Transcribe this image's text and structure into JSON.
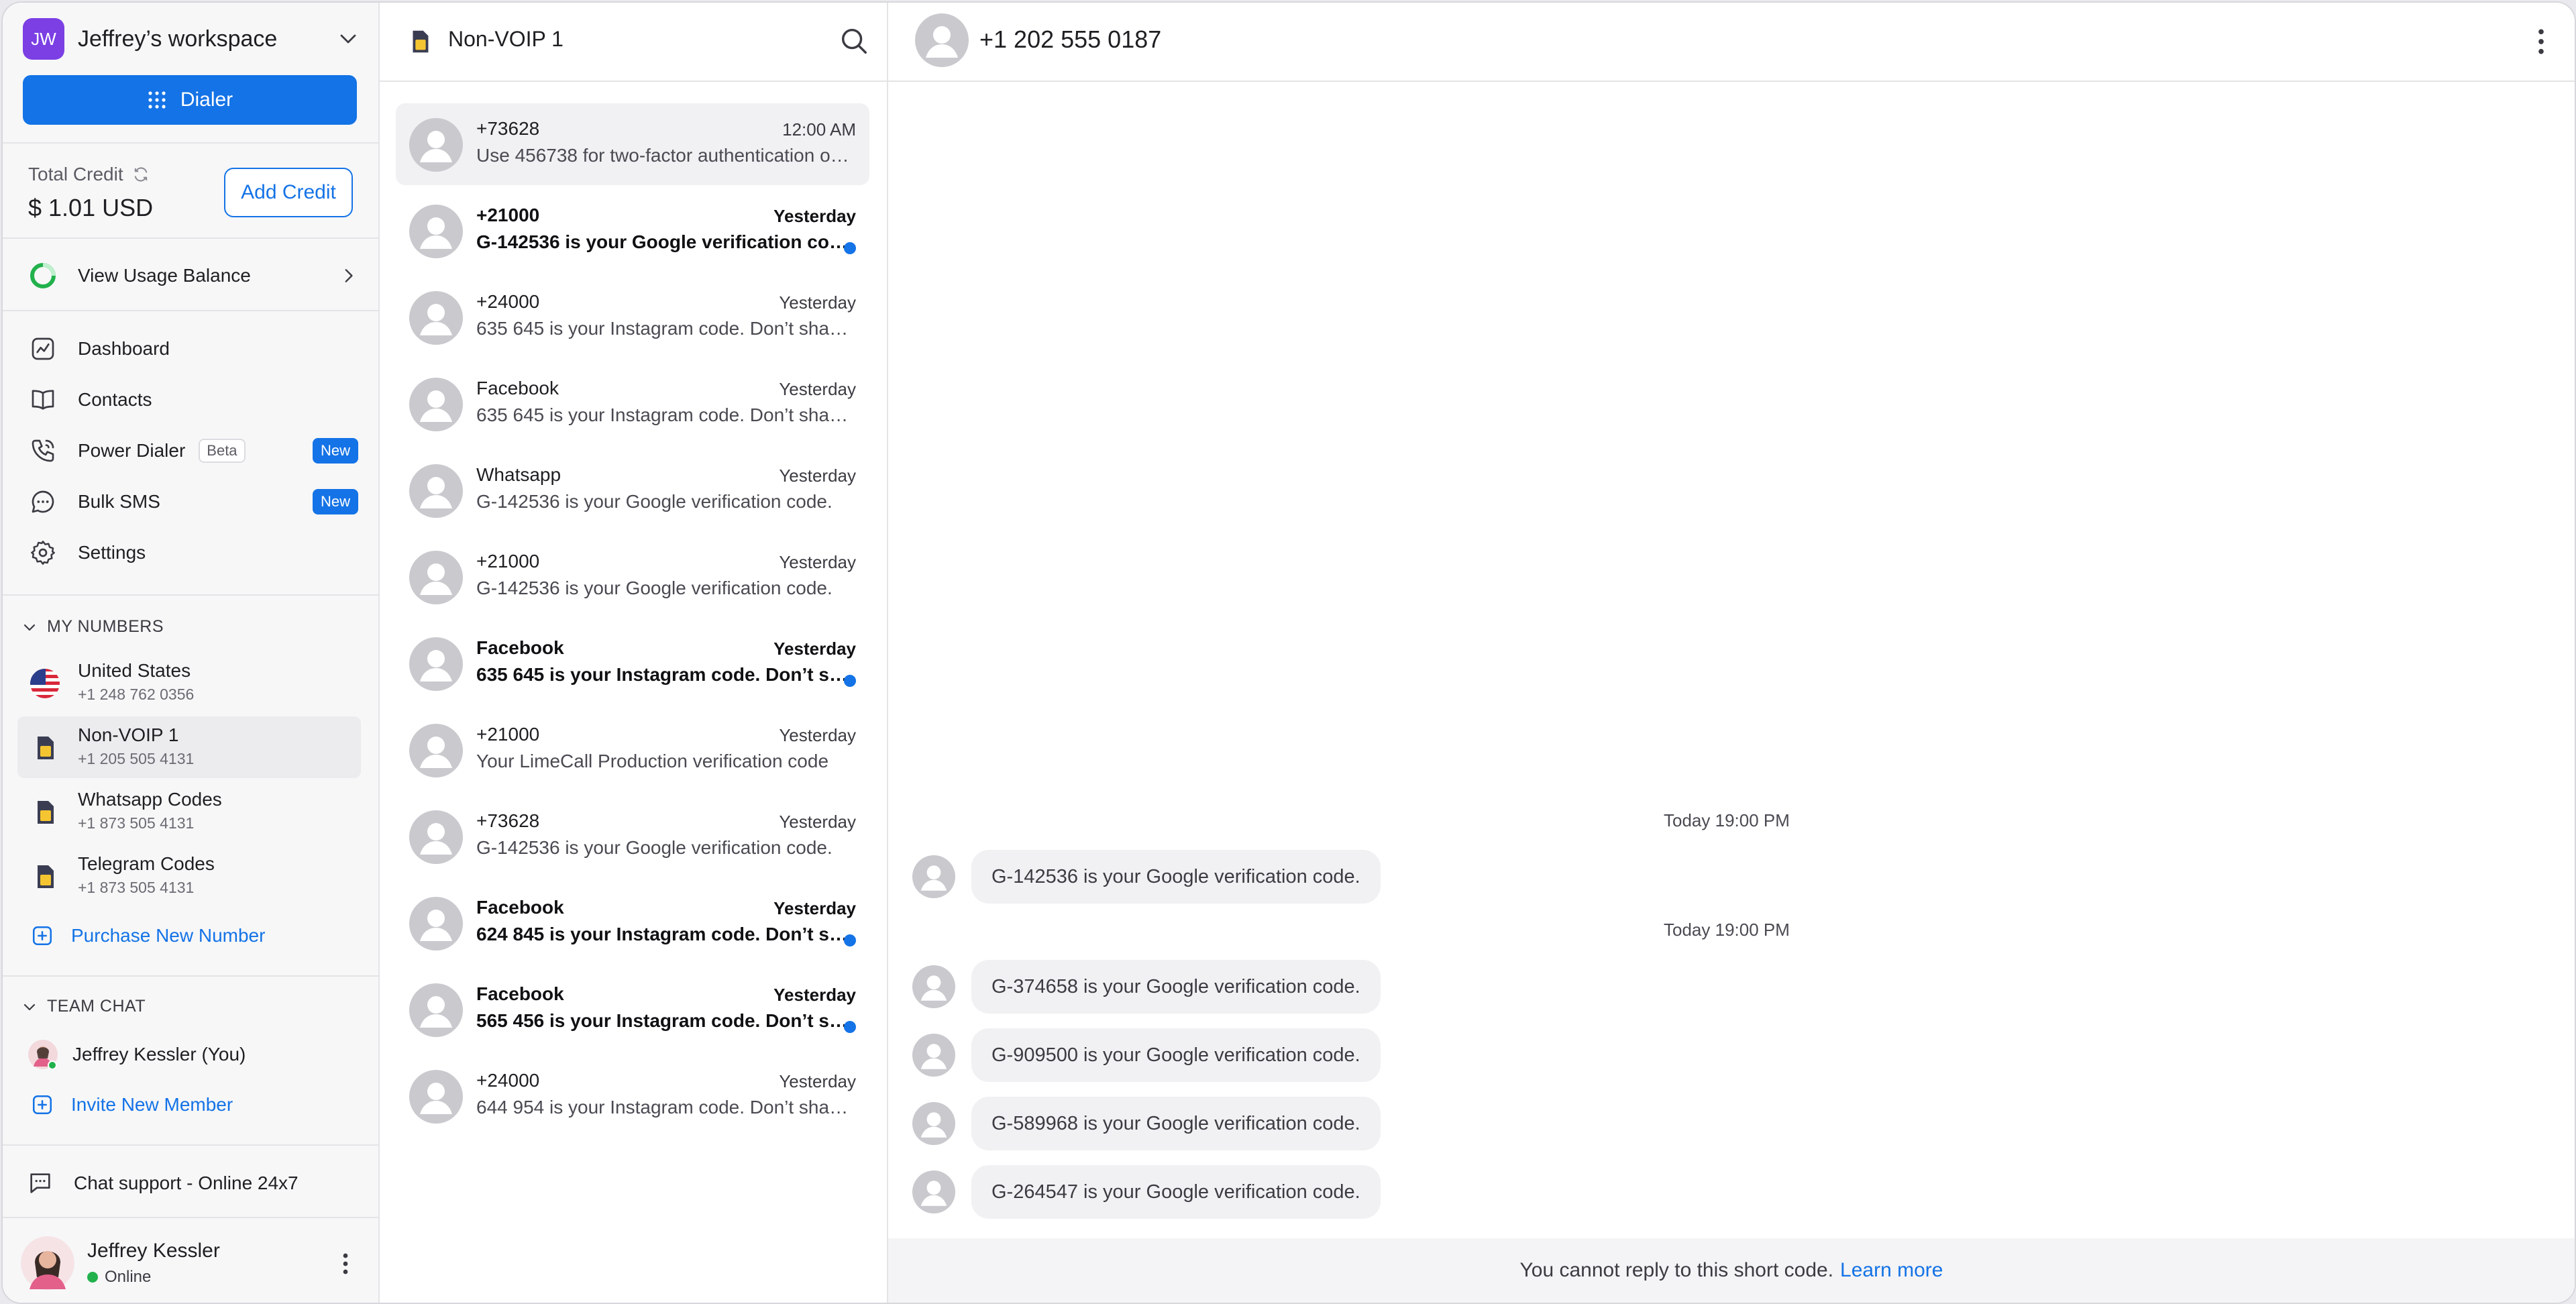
{
  "colors": {
    "accent": "#1473e6",
    "workspace_logo": "#7b3fe4",
    "online": "#22b14c",
    "unread_dot": "#1473e6"
  },
  "sidebar": {
    "workspace": {
      "initials": "JW",
      "name": "Jeffrey’s workspace"
    },
    "dialer_label": "Dialer",
    "credit": {
      "label": "Total Credit",
      "value": "$ 1.01 USD",
      "add_label": "Add Credit"
    },
    "usage_label": "View Usage Balance",
    "nav": [
      {
        "label": "Dashboard",
        "icon": "chart-icon"
      },
      {
        "label": "Contacts",
        "icon": "book-icon"
      },
      {
        "label": "Power Dialer",
        "icon": "phone-icon",
        "beta": "Beta",
        "badge": "New"
      },
      {
        "label": "Bulk SMS",
        "icon": "chat-bubble-icon",
        "badge": "New"
      },
      {
        "label": "Settings",
        "icon": "gear-icon"
      }
    ],
    "my_numbers": {
      "title": "MY NUMBERS",
      "items": [
        {
          "name": "United States",
          "number": "+1 248 762 0356",
          "icon": "us-flag-icon"
        },
        {
          "name": "Non-VOIP 1",
          "number": "+1 205 505 4131",
          "icon": "sim-card-icon",
          "active": true
        },
        {
          "name": "Whatsapp Codes",
          "number": "+1 873 505 4131",
          "icon": "sim-card-icon"
        },
        {
          "name": "Telegram Codes",
          "number": "+1 873 505 4131",
          "icon": "sim-card-icon"
        }
      ],
      "purchase_label": "Purchase New Number"
    },
    "team_chat": {
      "title": "TEAM CHAT",
      "member": "Jeffrey Kessler (You)",
      "invite_label": "Invite New Member"
    },
    "support_label": "Chat support - Online 24x7",
    "user": {
      "name": "Jeffrey Kessler",
      "status": "Online"
    }
  },
  "conversation_list": {
    "title": "Non-VOIP 1",
    "items": [
      {
        "name": "+73628",
        "time": "12:00 AM",
        "preview": "Use 456738 for two-factor authentication on LimeCall",
        "selected": true,
        "unread": false
      },
      {
        "name": "+21000",
        "time": "Yesterday",
        "preview": "G-142536 is your Google verification code.",
        "unread": true
      },
      {
        "name": "+24000",
        "time": "Yesterday",
        "preview": "635 645 is your Instagram code. Don’t share it",
        "unread": false
      },
      {
        "name": "Facebook",
        "time": "Yesterday",
        "preview": "635 645 is your Instagram code. Don’t share it",
        "unread": false
      },
      {
        "name": "Whatsapp",
        "time": "Yesterday",
        "preview": "G-142536 is your Google verification code.",
        "unread": false
      },
      {
        "name": "+21000",
        "time": "Yesterday",
        "preview": "G-142536 is your Google verification code.",
        "unread": false
      },
      {
        "name": "Facebook",
        "time": "Yesterday",
        "preview": "635 645 is your Instagram code. Don’t share it",
        "unread": true
      },
      {
        "name": "+21000",
        "time": "Yesterday",
        "preview": "Your LimeCall Production verification code",
        "unread": false
      },
      {
        "name": "+73628",
        "time": "Yesterday",
        "preview": "G-142536 is your Google verification code.",
        "unread": false
      },
      {
        "name": "Facebook",
        "time": "Yesterday",
        "preview": "624 845 is your Instagram code. Don’t share it",
        "unread": true
      },
      {
        "name": "Facebook",
        "time": "Yesterday",
        "preview": "565 456 is your Instagram code. Don’t share it",
        "unread": true
      },
      {
        "name": "+24000",
        "time": "Yesterday",
        "preview": "644 954 is your Instagram code. Don’t share it",
        "unread": false
      }
    ]
  },
  "thread": {
    "title": "+1 202 555 0187",
    "groups": [
      {
        "timestamp": "Today 19:00 PM",
        "messages": [
          "G-142536 is your Google verification code."
        ]
      },
      {
        "timestamp": "Today 19:00 PM",
        "messages": [
          "G-374658 is your Google verification code.",
          "G-909500 is your Google verification code.",
          "G-589968 is your Google verification code.",
          "G-264547 is your Google verification code."
        ]
      }
    ],
    "notice": "You cannot reply to this short code.",
    "learn_more": "Learn more"
  }
}
